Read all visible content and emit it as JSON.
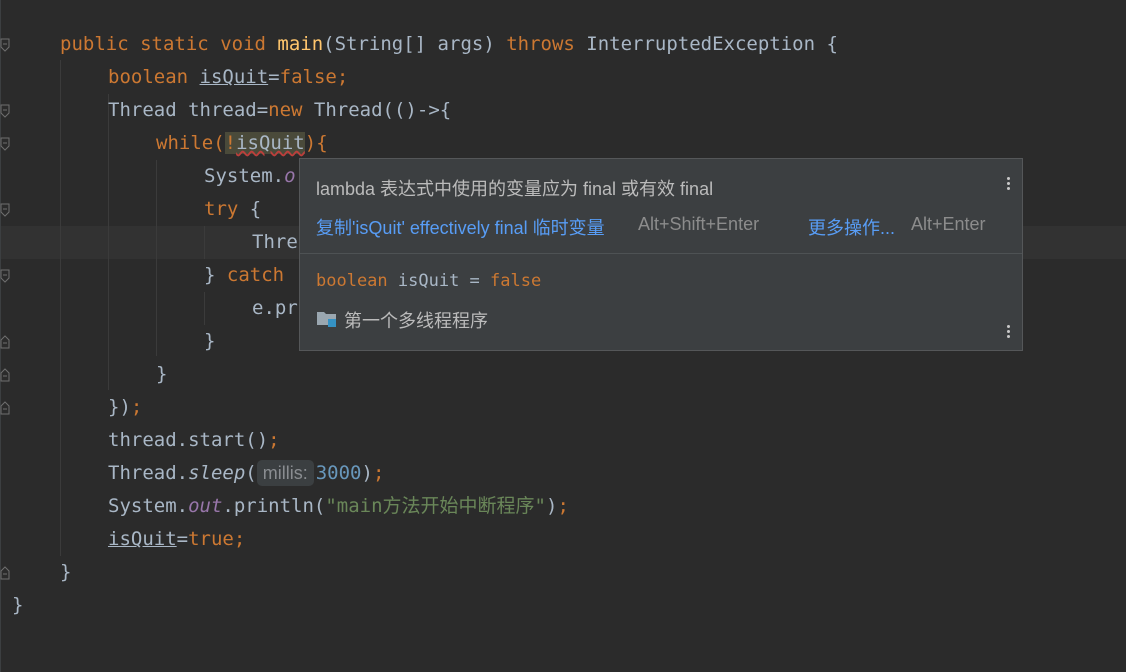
{
  "code": {
    "l1": {
      "public": "public",
      "static": "static",
      "void": "void",
      "main": "main",
      "params": "(String[] args) ",
      "throws": "throws",
      "exception": " InterruptedException {"
    },
    "l2": {
      "type": "boolean",
      "var": "isQuit",
      "eq": "=",
      "val": "false",
      "semi": ";"
    },
    "l3": {
      "decl": "Thread thread=",
      "new": "new",
      "rest": " Thread(()->{"
    },
    "l4": {
      "while": "while",
      "open": "(",
      "bang": "!",
      "var": "isQuit",
      "close": "){"
    },
    "l5": {
      "text": "System.",
      "field": "o"
    },
    "l6": {
      "try": "try",
      "rest": " {"
    },
    "l7": {
      "text": "Thre"
    },
    "l8": {
      "close": "} ",
      "catch": "catch"
    },
    "l9": {
      "text": "e.pr"
    },
    "l10": {
      "text": "}"
    },
    "l11": {
      "text": "}"
    },
    "l12": {
      "text": "})",
      "semi": ";"
    },
    "l13": {
      "text": "thread.start()",
      "semi": ";"
    },
    "l14": {
      "cls": "Thread.",
      "method": "sleep",
      "open": "(",
      "hint": "millis:",
      "num": "3000",
      "close": ")",
      "semi": ";"
    },
    "l15": {
      "cls": "System.",
      "field": "out",
      "call": ".println(",
      "str": "\"main方法开始中断程序\"",
      "close": ")",
      "semi": ";"
    },
    "l16": {
      "var": "isQuit",
      "eq": "=",
      "val": "true",
      "semi": ";"
    },
    "l17": {
      "text": "}"
    },
    "l18": {
      "text": "}"
    }
  },
  "popup": {
    "title": "lambda 表达式中使用的变量应为 final 或有效 final",
    "fix_label": "复制'isQuit' effectively final 临时变量",
    "fix_shortcut": "Alt+Shift+Enter",
    "more_label": "更多操作...",
    "more_shortcut": "Alt+Enter",
    "decl_type": "boolean",
    "decl_rest": " isQuit = ",
    "decl_val": "false",
    "module_name": "第一个多线程程序",
    "module_icon": "module-folder-icon",
    "menu_icon": "more-vertical-icon"
  }
}
